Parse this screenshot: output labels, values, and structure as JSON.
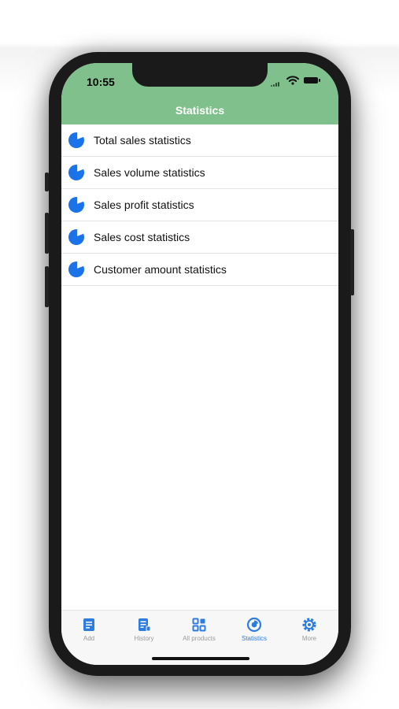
{
  "status_bar": {
    "time": "10:55"
  },
  "header": {
    "title": "Statistics",
    "color": "#80c08c"
  },
  "list": {
    "items": [
      {
        "label": "Total sales statistics",
        "icon": "pie-chart-icon"
      },
      {
        "label": "Sales volume statistics",
        "icon": "pie-chart-icon"
      },
      {
        "label": "Sales profit statistics",
        "icon": "pie-chart-icon"
      },
      {
        "label": "Sales cost statistics",
        "icon": "pie-chart-icon"
      },
      {
        "label": "Customer amount statistics",
        "icon": "pie-chart-icon"
      }
    ]
  },
  "tabbar": {
    "active_color": "#2d7de0",
    "inactive_color": "#9a9a9a",
    "tabs": [
      {
        "label": "Add",
        "icon": "add-document-icon",
        "active": false
      },
      {
        "label": "History",
        "icon": "history-document-icon",
        "active": false
      },
      {
        "label": "All products",
        "icon": "grid-icon",
        "active": false
      },
      {
        "label": "Statistics",
        "icon": "statistics-chart-icon",
        "active": true
      },
      {
        "label": "More",
        "icon": "gear-icon",
        "active": false
      }
    ]
  }
}
